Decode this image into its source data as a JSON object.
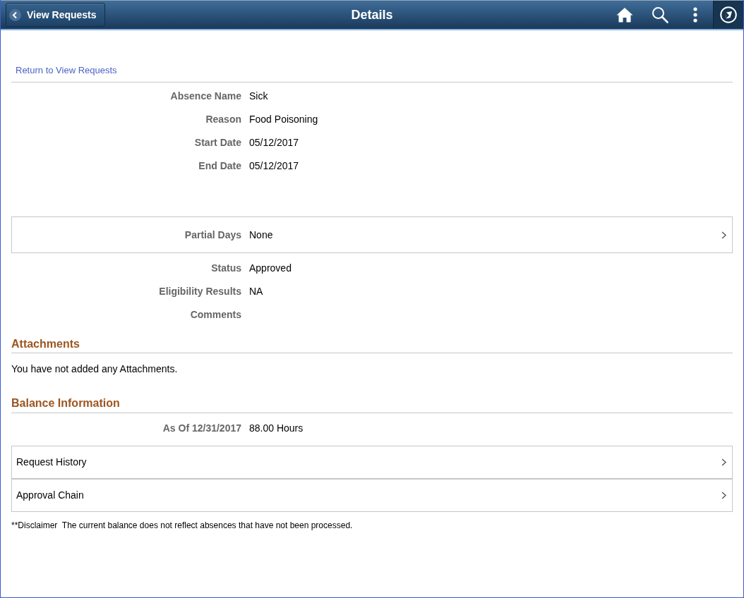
{
  "header": {
    "back_button": "View Requests",
    "title": "Details"
  },
  "return_link": "Return to View Requests",
  "absence_fields": [
    {
      "label": "Absence Name",
      "value": "Sick"
    },
    {
      "label": "Reason",
      "value": "Food Poisoning"
    },
    {
      "label": "Start Date",
      "value": "05/12/2017"
    },
    {
      "label": "End Date",
      "value": "05/12/2017"
    }
  ],
  "partial_days": {
    "label": "Partial Days",
    "value": "None"
  },
  "status_fields": [
    {
      "label": "Status",
      "value": "Approved"
    },
    {
      "label": "Eligibility Results",
      "value": "NA"
    },
    {
      "label": "Comments"
    }
  ],
  "attachments": {
    "heading": "Attachments",
    "message": "You have not added any Attachments."
  },
  "balance": {
    "heading": "Balance Information",
    "label": "As Of 12/31/2017",
    "value": "88.00 Hours"
  },
  "nav_rows": [
    {
      "label": "Request History"
    },
    {
      "label": "Approval Chain"
    }
  ],
  "disclaimer": "**Disclaimer  The current balance does not reflect absences that have not been processed."
}
